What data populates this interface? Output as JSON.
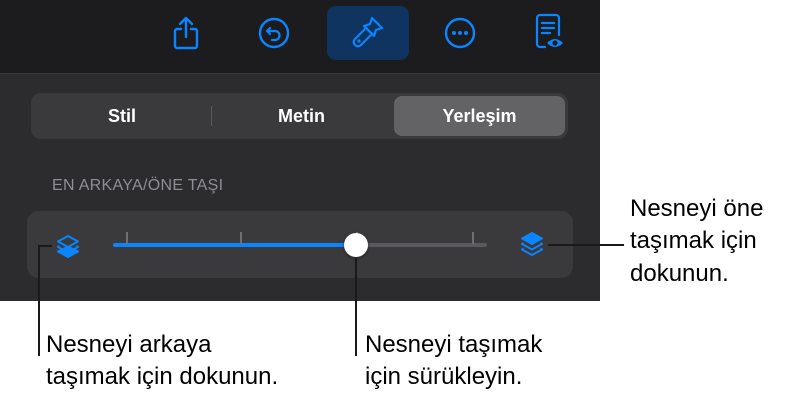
{
  "toolbar": {
    "buttons": [
      {
        "name": "share-button",
        "icon": "share-icon"
      },
      {
        "name": "undo-button",
        "icon": "undo-icon"
      },
      {
        "name": "format-button",
        "icon": "paintbrush-icon",
        "active": true
      },
      {
        "name": "more-button",
        "icon": "ellipsis-icon"
      },
      {
        "name": "reading-view-button",
        "icon": "document-eye-icon"
      }
    ]
  },
  "tabs": {
    "items": [
      "Stil",
      "Metin",
      "Yerleşim"
    ],
    "selected": "Yerleşim"
  },
  "arrange": {
    "section_label": "EN ARKAYA/ÖNE TAŞI",
    "back_icon": "layers-back-icon",
    "front_icon": "layers-front-icon",
    "slider_level": 0.65,
    "tick_count": 4
  },
  "callouts": {
    "front": [
      "Nesneyi öne",
      "taşımak için",
      "dokunun."
    ],
    "back": [
      "Nesneyi arkaya",
      "taşımak için dokunun."
    ],
    "drag": [
      "Nesneyi taşımak",
      "için sürükleyin."
    ]
  },
  "colors": {
    "accent": "#0a84ff",
    "panel_bg": "#2c2c2e",
    "toolbar_bg": "#1c1c1e",
    "selected_tab": "#636366"
  }
}
